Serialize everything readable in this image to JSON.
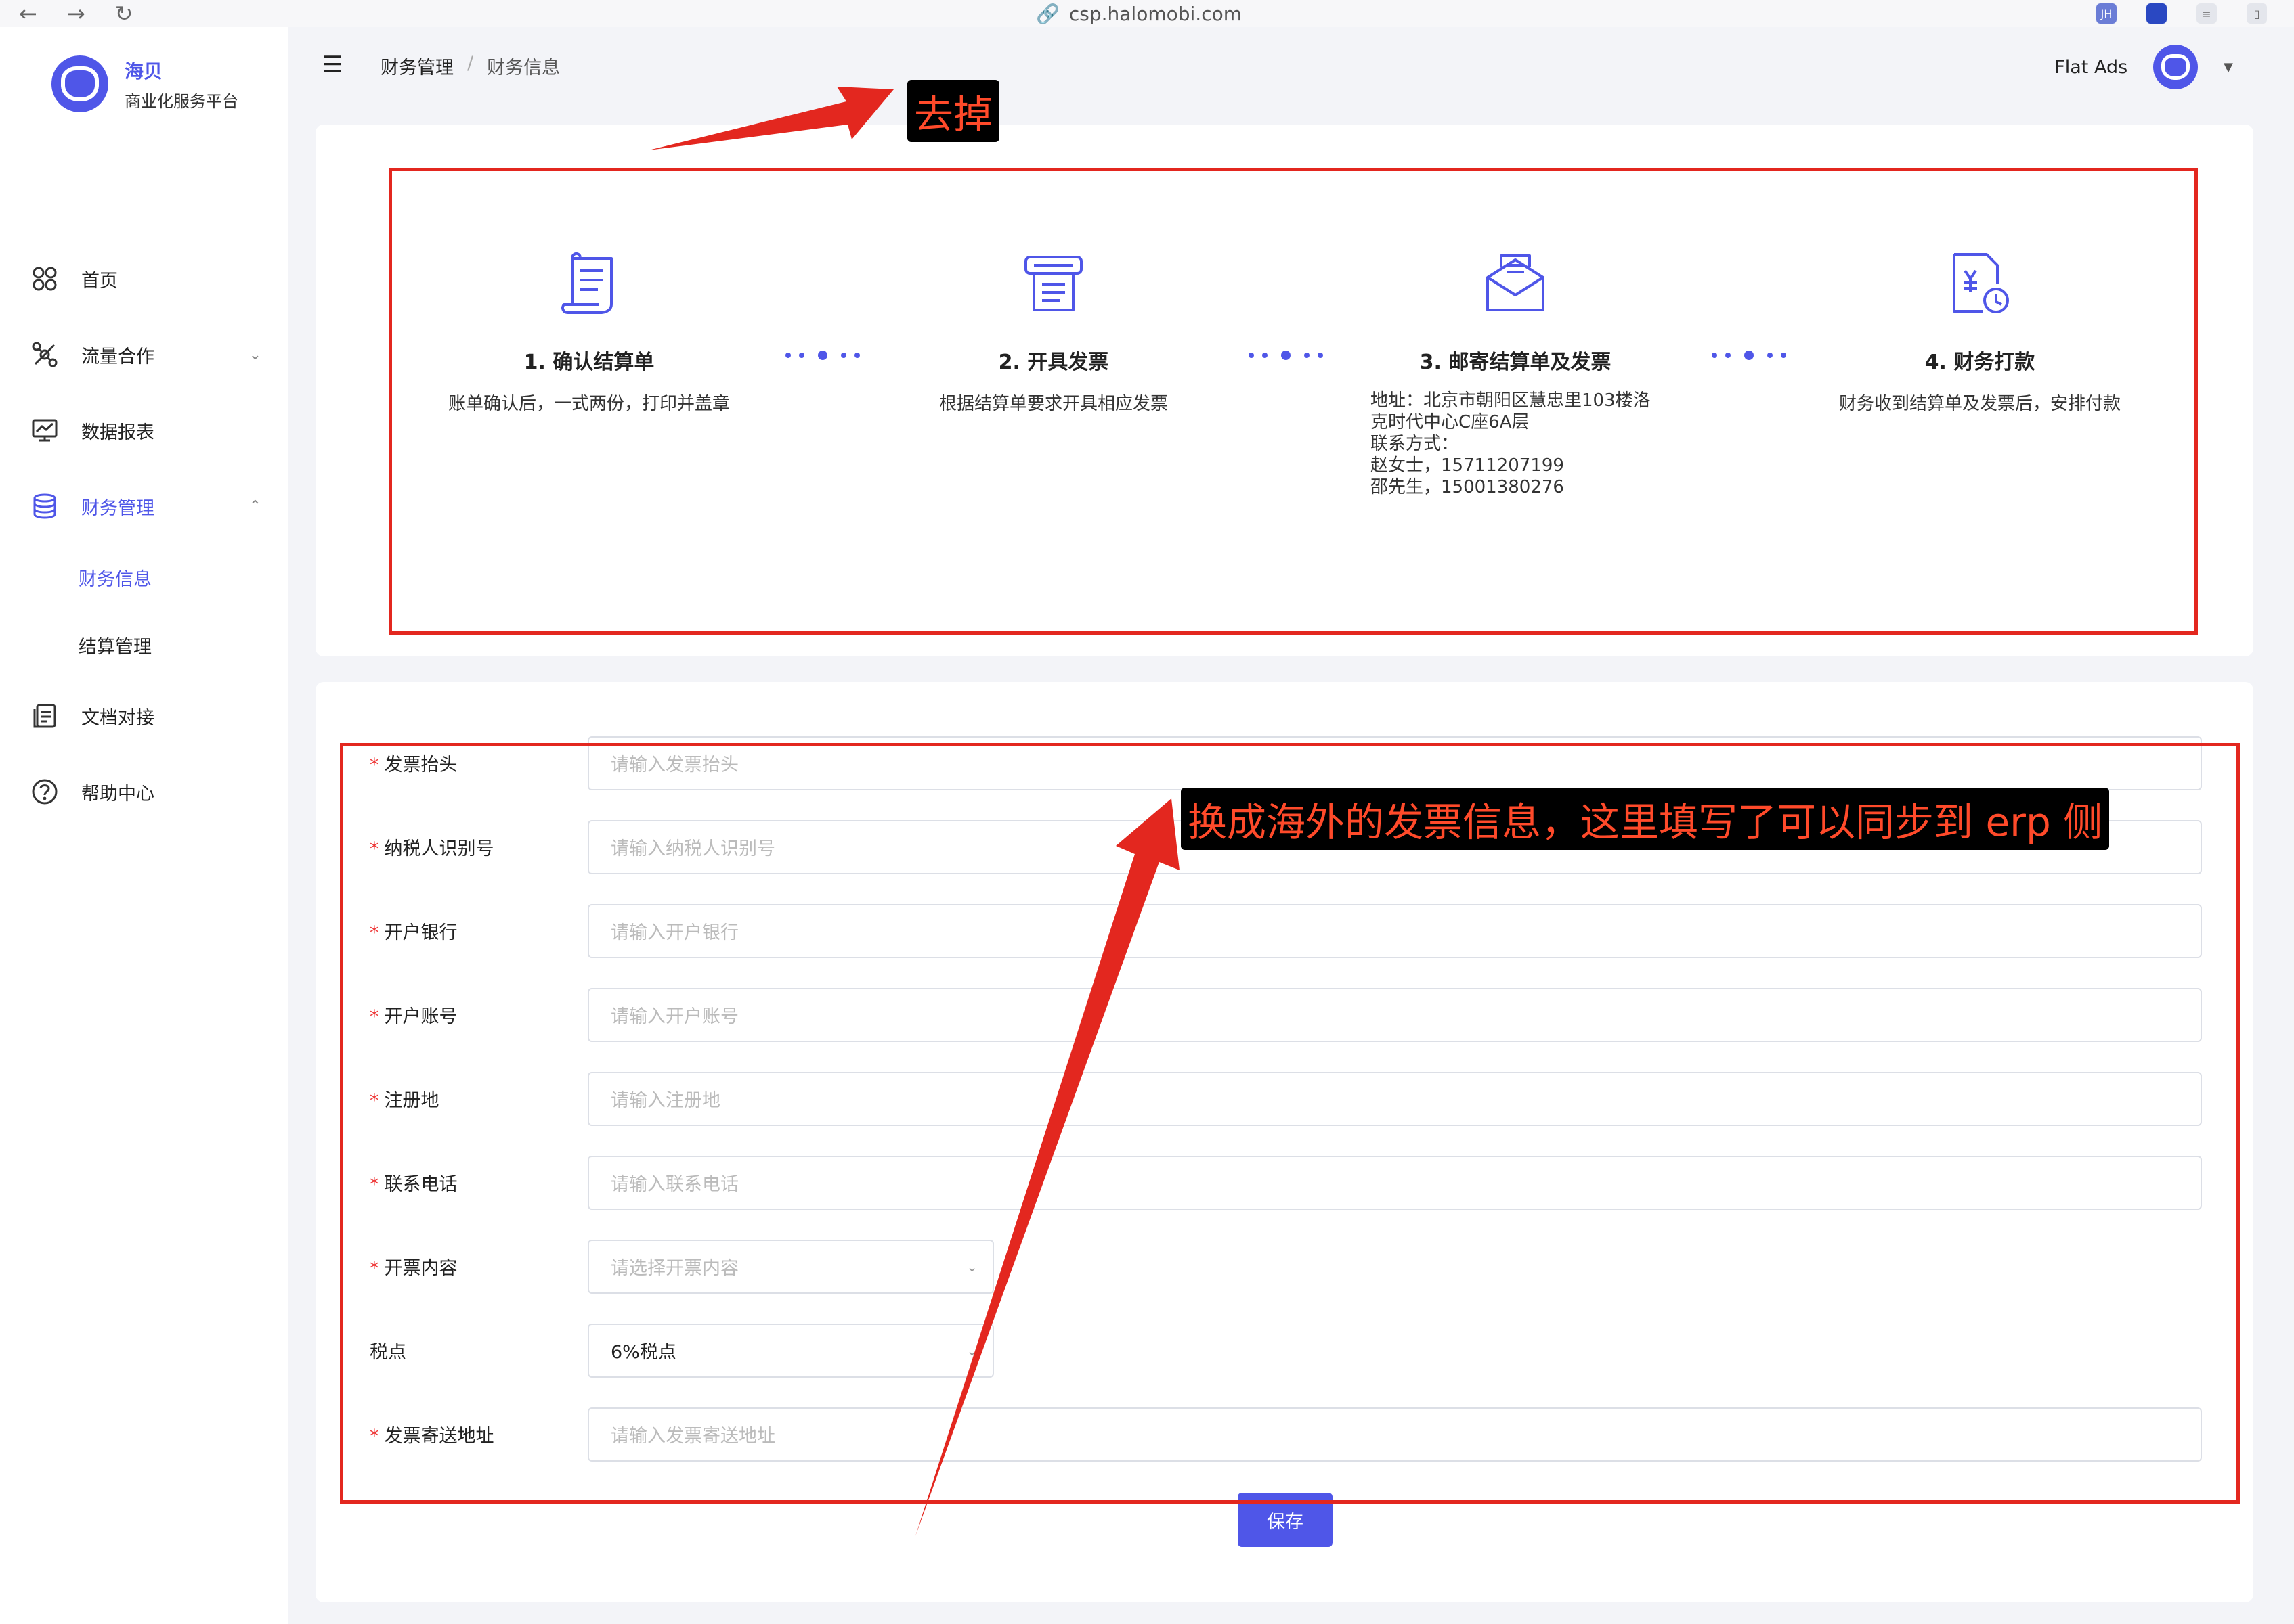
{
  "browser": {
    "url": "csp.halomobi.com",
    "ext_badge": "JH"
  },
  "sidebar": {
    "logo_title": "海贝",
    "logo_subtitle": "商业化服务平台",
    "items": [
      {
        "label": "首页",
        "icon": "dashboard-icon"
      },
      {
        "label": "流量合作",
        "icon": "network-icon"
      },
      {
        "label": "数据报表",
        "icon": "report-icon"
      },
      {
        "label": "财务管理",
        "icon": "database-icon"
      },
      {
        "label": "文档对接",
        "icon": "document-icon"
      },
      {
        "label": "帮助中心",
        "icon": "help-icon"
      }
    ],
    "sub_items": [
      {
        "label": "财务信息"
      },
      {
        "label": "结算管理"
      }
    ]
  },
  "topbar": {
    "breadcrumb_root": "财务管理",
    "breadcrumb_sep": "/",
    "breadcrumb_current": "财务信息",
    "user_name": "Flat Ads"
  },
  "steps": [
    {
      "title": "1. 确认结算单",
      "desc": "账单确认后，一式两份，打印并盖章",
      "icon": "contract-icon"
    },
    {
      "title": "2. 开具发票",
      "desc": "根据结算单要求开具相应发票",
      "icon": "invoice-icon"
    },
    {
      "title": "3. 邮寄结算单及发票",
      "desc_lines": [
        "地址：北京市朝阳区慧忠里103楼洛",
        "克时代中心C座6A层",
        "联系方式：",
        "赵女士，15711207199",
        "邵先生，15001380276"
      ],
      "icon": "mail-icon"
    },
    {
      "title": "4. 财务打款",
      "desc": "财务收到结算单及发票后，安排付款",
      "icon": "payment-icon"
    }
  ],
  "form": {
    "fields": [
      {
        "label": "发票抬头",
        "required": true,
        "placeholder": "请输入发票抬头"
      },
      {
        "label": "纳税人识别号",
        "required": true,
        "placeholder": "请输入纳税人识别号"
      },
      {
        "label": "开户银行",
        "required": true,
        "placeholder": "请输入开户银行"
      },
      {
        "label": "开户账号",
        "required": true,
        "placeholder": "请输入开户账号"
      },
      {
        "label": "注册地",
        "required": true,
        "placeholder": "请输入注册地"
      },
      {
        "label": "联系电话",
        "required": true,
        "placeholder": "请输入联系电话"
      },
      {
        "label": "开票内容",
        "required": true,
        "placeholder": "请选择开票内容"
      },
      {
        "label": "税点",
        "required": false,
        "value": "6%税点"
      },
      {
        "label": "发票寄送地址",
        "required": true,
        "placeholder": "请输入发票寄送地址"
      }
    ],
    "save_label": "保存",
    "required_mark": "*"
  },
  "annotations": {
    "top_label": "去掉",
    "form_label": "换成海外的发票信息，这里填写了可以同步到 erp 侧",
    "color": "#e3271f"
  },
  "theme": {
    "accent": "#4f56e8",
    "background": "#f3f4f8"
  }
}
